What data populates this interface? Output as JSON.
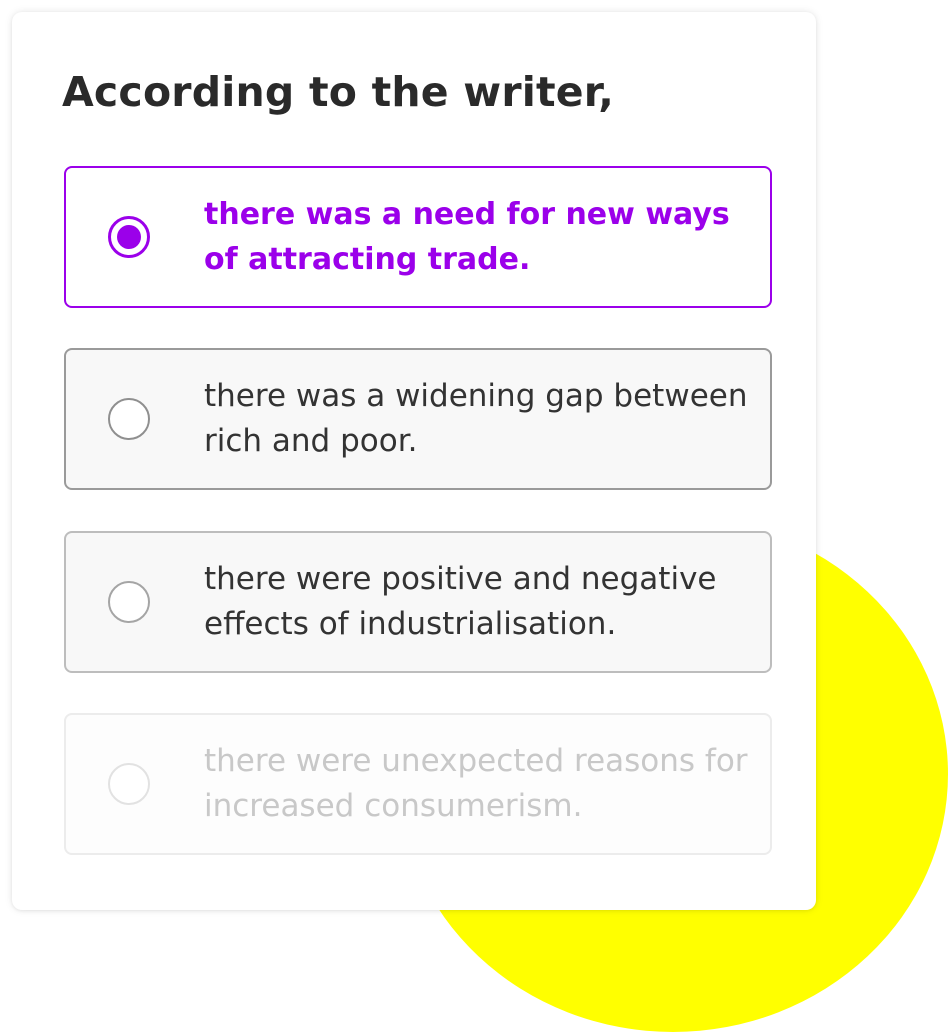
{
  "colors": {
    "accent": "#9b00ea",
    "decoration": "#ffff00"
  },
  "question": {
    "text": "According to the writer,"
  },
  "options": [
    {
      "text": "there was a need for new ways of attracting trade.",
      "selected": true
    },
    {
      "text": "there was a widening gap between rich and poor.",
      "selected": false
    },
    {
      "text": "there were positive and negative effects of industrialisation.",
      "selected": false
    },
    {
      "text": "there were unexpected reasons for increased consumerism.",
      "selected": false
    }
  ]
}
